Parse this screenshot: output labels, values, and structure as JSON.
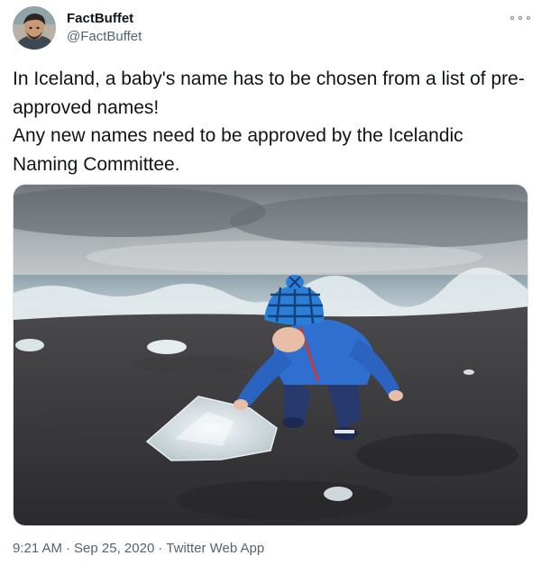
{
  "author": {
    "display_name": "FactBuffet",
    "handle": "@FactBuffet",
    "avatar_icon": "user-avatar-photo"
  },
  "more_icon": "more-options-icon",
  "tweet": {
    "lines": [
      "In Iceland, a baby's name has to be chosen from a list of pre-approved names!",
      "Any new names need to be approved by the Icelandic Naming Committee."
    ]
  },
  "media": {
    "kind": "photo",
    "scene": "toddler-on-black-sand-beach-with-ice"
  },
  "meta": {
    "time": "9:21 AM",
    "date": "Sep 25, 2020",
    "separator": "·",
    "source": "Twitter Web App"
  },
  "colors": {
    "text": "#0f1419",
    "secondary": "#536471",
    "jacket": "#2f6fd0",
    "hat": "#2a7fd6"
  }
}
